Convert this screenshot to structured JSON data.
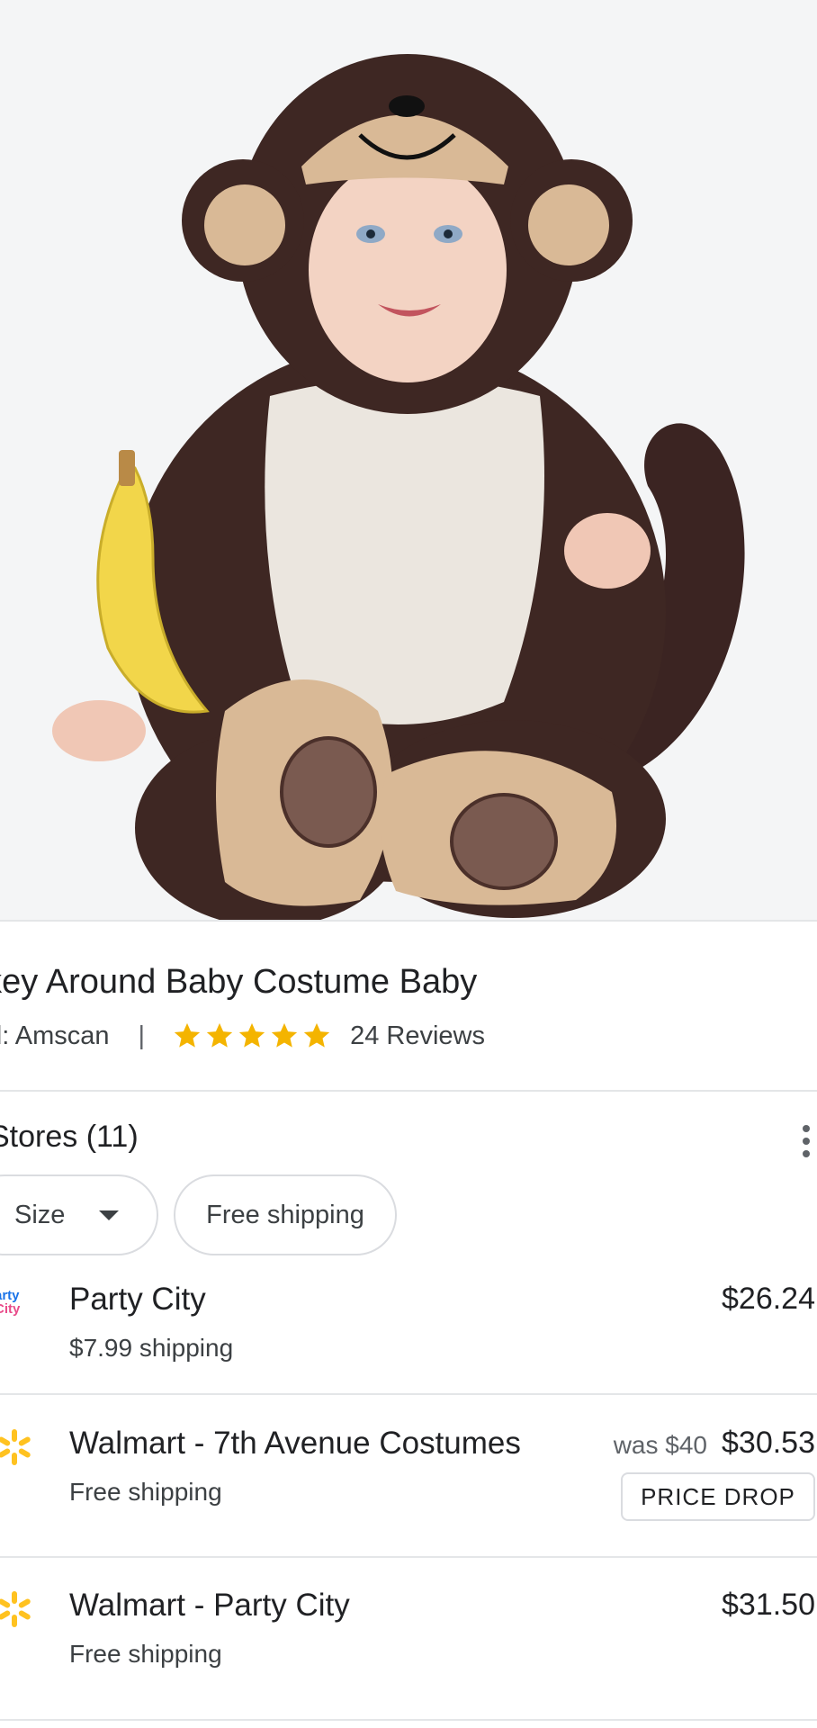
{
  "product": {
    "title": "nkey Around Baby Costume Baby",
    "brand_label": "nd: Amscan",
    "separator": "|",
    "rating_stars": 5,
    "reviews": "24 Reviews"
  },
  "stores": {
    "header": "Stores (11)",
    "filters": [
      {
        "label": "Size",
        "has_dropdown": true
      },
      {
        "label": "Free shipping",
        "has_dropdown": false
      }
    ],
    "items": [
      {
        "name": "Party City",
        "shipping": "$7.99 shipping",
        "price": "$26.24",
        "logo": "party-city-logo",
        "logo_text_1": "arty",
        "logo_text_2": "City"
      },
      {
        "name": "Walmart - 7th Avenue Costumes",
        "shipping": "Free shipping",
        "price": "$30.53",
        "was_price": "was $40",
        "badge": "PRICE DROP",
        "logo": "walmart-spark-logo"
      },
      {
        "name": "Walmart - Party City",
        "shipping": "Free shipping",
        "price": "$31.50",
        "logo": "walmart-spark-logo"
      }
    ]
  },
  "colors": {
    "star": "#f4b400",
    "walmart_spark": "#ffc220",
    "divider": "#e4e6e8"
  }
}
